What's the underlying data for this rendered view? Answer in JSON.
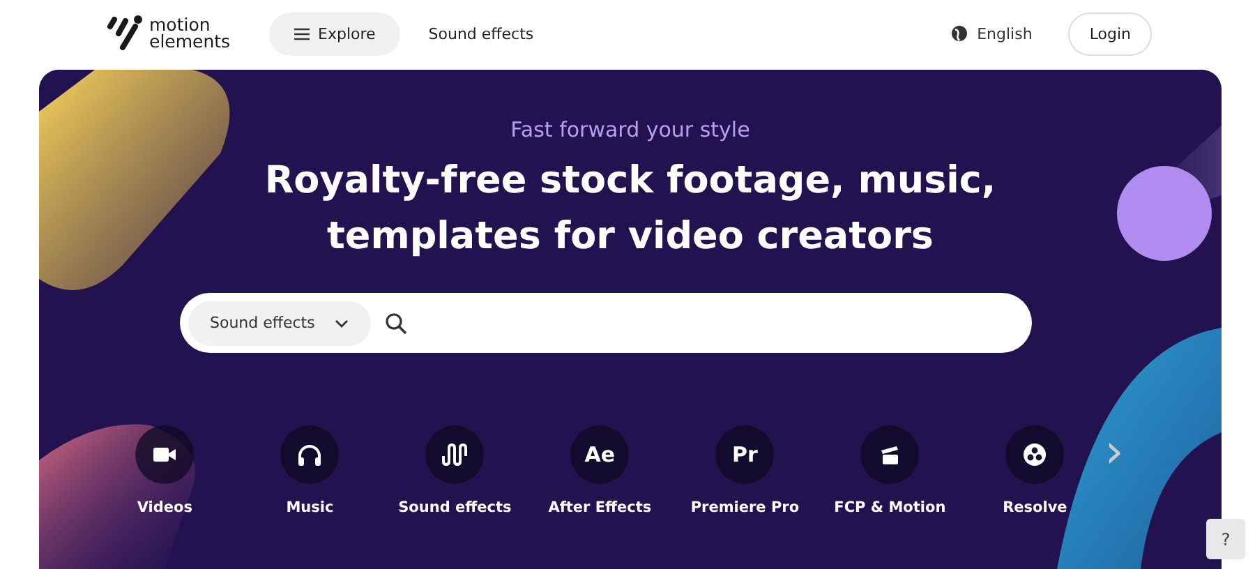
{
  "header": {
    "logo": "motion elements",
    "nav": [
      {
        "label": "Explore",
        "kind": "menu"
      },
      {
        "label": "Sound effects",
        "kind": "link"
      }
    ],
    "language": "English",
    "login": "Login"
  },
  "hero": {
    "tagline": "Fast forward your style",
    "headline": "Royalty-free stock footage, music, templates for video creators",
    "search": {
      "category": "Sound effects"
    },
    "categories": [
      {
        "label": "Videos",
        "kind": "video"
      },
      {
        "label": "Music",
        "kind": "music"
      },
      {
        "label": "Sound effects",
        "kind": "sound"
      },
      {
        "label": "After Effects",
        "kind": "glyph",
        "glyph": "Ae"
      },
      {
        "label": "Premiere Pro",
        "kind": "glyph",
        "glyph": "Pr"
      },
      {
        "label": "FCP & Motion",
        "kind": "fcp"
      },
      {
        "label": "Resolve",
        "kind": "resolve"
      }
    ],
    "next": "›"
  },
  "help": "?"
}
